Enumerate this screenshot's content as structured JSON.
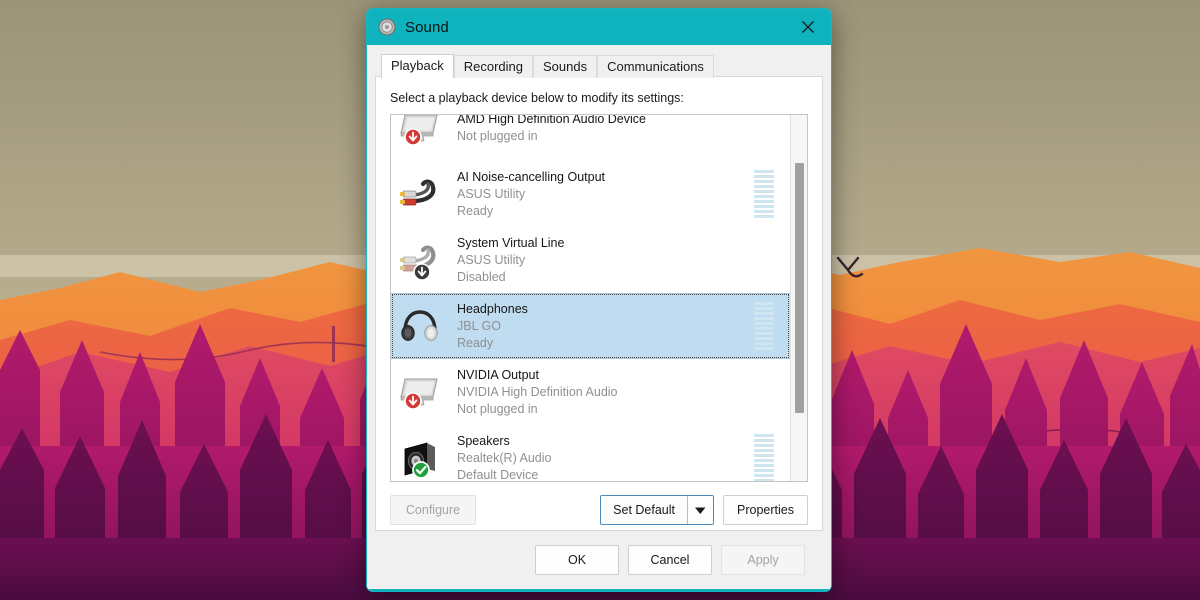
{
  "window": {
    "title": "Sound",
    "icon": "speaker-icon",
    "close_label": "✕",
    "accent_color": "#0fb3be"
  },
  "tabs": [
    {
      "label": "Playback",
      "active": true
    },
    {
      "label": "Recording",
      "active": false
    },
    {
      "label": "Sounds",
      "active": false
    },
    {
      "label": "Communications",
      "active": false
    }
  ],
  "playback": {
    "instruction": "Select a playback device below to modify its settings:",
    "devices": [
      {
        "name": "AMD High Definition Audio Device",
        "subtitle": "",
        "status": "Not plugged in",
        "icon": "monitor-icon",
        "badge": "not-plugged-icon",
        "selected": false,
        "meter": "none",
        "clipped": true
      },
      {
        "name": "AI Noise-cancelling Output",
        "subtitle": "ASUS Utility",
        "status": "Ready",
        "icon": "rca-cable-icon",
        "badge": "none",
        "selected": false,
        "meter": "active"
      },
      {
        "name": "System Virtual Line",
        "subtitle": "ASUS Utility",
        "status": "Disabled",
        "icon": "rca-cable-icon",
        "badge": "disabled-icon",
        "selected": false,
        "meter": "none"
      },
      {
        "name": "Headphones",
        "subtitle": "JBL GO",
        "status": "Ready",
        "icon": "headphones-icon",
        "badge": "none",
        "selected": true,
        "meter": "active"
      },
      {
        "name": "NVIDIA Output",
        "subtitle": "NVIDIA High Definition Audio",
        "status": "Not plugged in",
        "icon": "monitor-icon",
        "badge": "not-plugged-icon",
        "selected": false,
        "meter": "none"
      },
      {
        "name": "Speakers",
        "subtitle": "Realtek(R) Audio",
        "status": "Default Device",
        "icon": "speaker-box-icon",
        "badge": "default-check-icon",
        "selected": false,
        "meter": "active"
      }
    ],
    "scroll": {
      "thumb_top_pct": 13,
      "thumb_height_pct": 68
    }
  },
  "buttons": {
    "configure": {
      "label": "Configure",
      "enabled": false
    },
    "set_default": {
      "label": "Set Default",
      "enabled": true,
      "has_dropdown": true,
      "dropdown_glyph": "▼"
    },
    "properties": {
      "label": "Properties",
      "enabled": true
    },
    "ok": {
      "label": "OK",
      "enabled": true
    },
    "cancel": {
      "label": "Cancel",
      "enabled": true
    },
    "apply": {
      "label": "Apply",
      "enabled": false
    }
  }
}
